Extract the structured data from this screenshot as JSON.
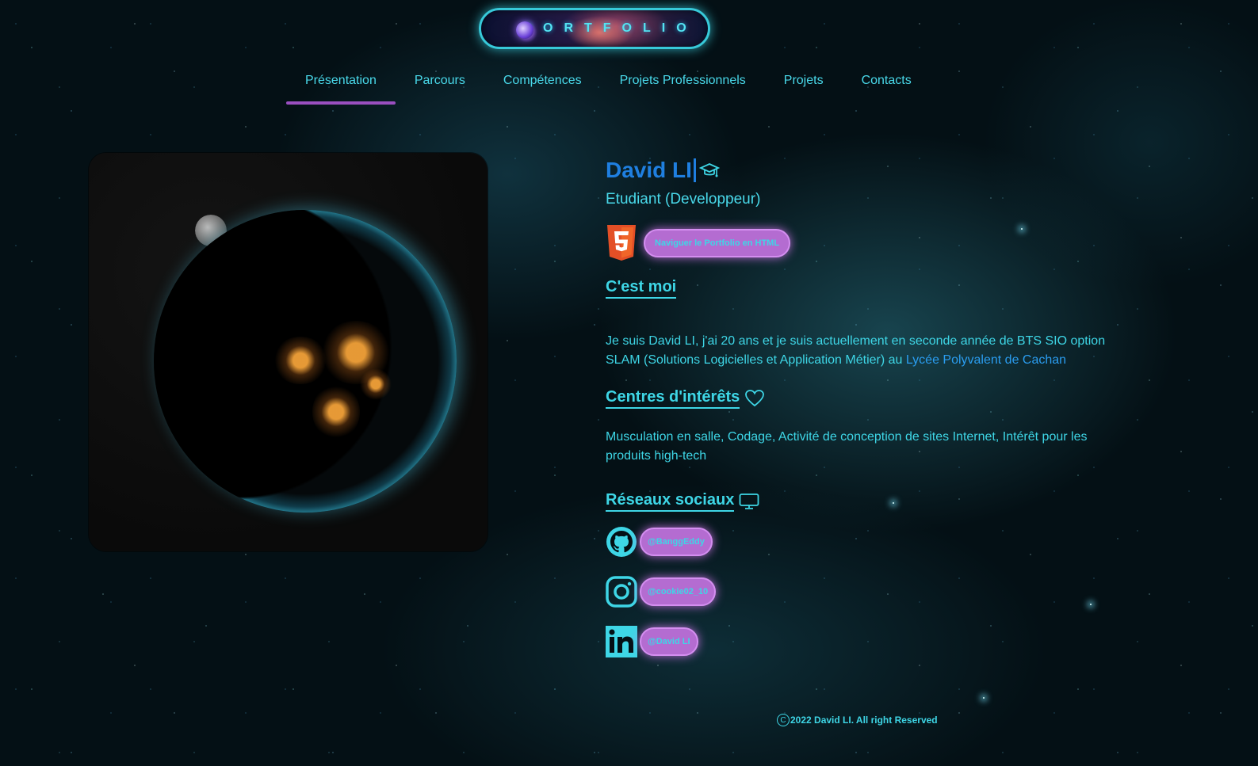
{
  "logo": {
    "text": "PORTFOLIO"
  },
  "nav": {
    "items": [
      {
        "label": "Présentation",
        "active": true
      },
      {
        "label": "Parcours"
      },
      {
        "label": "Compétences"
      },
      {
        "label": "Projets Professionnels"
      },
      {
        "label": "Projets"
      },
      {
        "label": "Contacts"
      }
    ]
  },
  "profile": {
    "name": "David LI",
    "role": "Etudiant (Developpeur)",
    "html_button": "Naviguer le Portfolio en HTML"
  },
  "about": {
    "title": "C'est moi",
    "text_before_link": "Je suis David LI, j'ai 20 ans et je suis actuellement en seconde année de BTS SIO option SLAM (Solutions Logicielles et Application Métier) au ",
    "link": "Lycée Polyvalent de Cachan"
  },
  "interests": {
    "title": "Centres d'intérêts",
    "text": "Musculation en salle, Codage, Activité de conception de sites Internet, Intérêt pour les produits high-tech"
  },
  "social": {
    "title": "Réseaux sociaux",
    "items": [
      {
        "icon": "github-icon",
        "handle": "@BanggEddy"
      },
      {
        "icon": "instagram-icon",
        "handle": "@cookie02_10"
      },
      {
        "icon": "linkedin-icon",
        "handle": "@David LI"
      }
    ]
  },
  "footer": {
    "copyright_symbol": "C",
    "text": "2022 David LI. All right Reserved"
  },
  "colors": {
    "accent": "#3ed6e6",
    "name": "#1f7fe0",
    "pill": "#b46cd1",
    "nav_active_bar": "#9a4fc0",
    "link": "#2a9df0"
  }
}
